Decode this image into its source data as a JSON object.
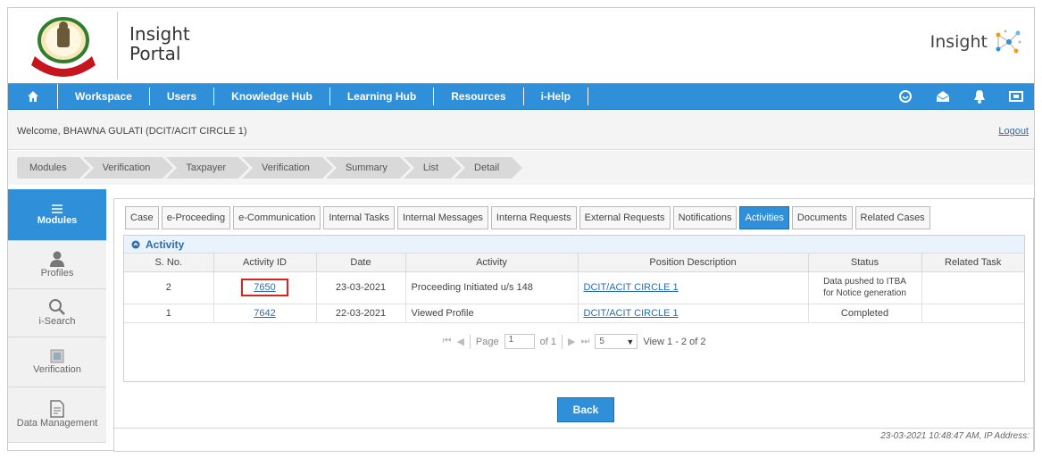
{
  "header": {
    "portal_title_line1": "Insight",
    "portal_title_line2": "Portal",
    "brand_text": "Insight"
  },
  "nav": {
    "items": [
      "Workspace",
      "Users",
      "Knowledge Hub",
      "Learning Hub",
      "Resources",
      "i-Help"
    ]
  },
  "welcome_text": "Welcome, BHAWNA GULATI (DCIT/ACIT CIRCLE 1)",
  "logout_label": "Logout",
  "breadcrumb": [
    "Modules",
    "Verification",
    "Taxpayer",
    "Verification",
    "Summary",
    "List",
    "Detail"
  ],
  "sidebar": {
    "items": [
      {
        "label": "Modules",
        "icon": "modules-icon"
      },
      {
        "label": "Profiles",
        "icon": "user-icon"
      },
      {
        "label": "i-Search",
        "icon": "search-icon"
      },
      {
        "label": "Verification",
        "icon": "verification-icon"
      },
      {
        "label": "Data Management",
        "icon": "document-icon"
      }
    ]
  },
  "tabs": [
    "Case",
    "e-Proceeding",
    "e-Communication",
    "Internal Tasks",
    "Internal Messages",
    "Interna Requests",
    "External Requests",
    "Notifications",
    "Activities",
    "Documents",
    "Related Cases"
  ],
  "active_tab": "Activities",
  "activity_panel": {
    "title": "Activity",
    "columns": [
      "S. No.",
      "Activity ID",
      "Date",
      "Activity",
      "Position Description",
      "Status",
      "Related Task"
    ],
    "rows": [
      {
        "sno": "2",
        "activity_id": "7650",
        "date": "23-03-2021",
        "activity": "Proceeding Initiated u/s 148",
        "position": "DCIT/ACIT CIRCLE 1",
        "status_line1": "Data pushed to ITBA",
        "status_line2": "for Notice generation",
        "related": ""
      },
      {
        "sno": "1",
        "activity_id": "7642",
        "date": "22-03-2021",
        "activity": "Viewed Profile",
        "position": "DCIT/ACIT CIRCLE 1",
        "status_line1": "Completed",
        "status_line2": "",
        "related": ""
      }
    ]
  },
  "pager": {
    "page_label": "Page",
    "page_value": "1",
    "of_label": "of 1",
    "page_size": "5",
    "view_text": "View 1 - 2 of 2"
  },
  "back_label": "Back",
  "footer_stamp": "23-03-2021 10:48:47 AM, IP Address:",
  "colors": {
    "primary": "#2f8fd8",
    "highlight_border": "#d9231f",
    "link": "#2a6db0"
  }
}
